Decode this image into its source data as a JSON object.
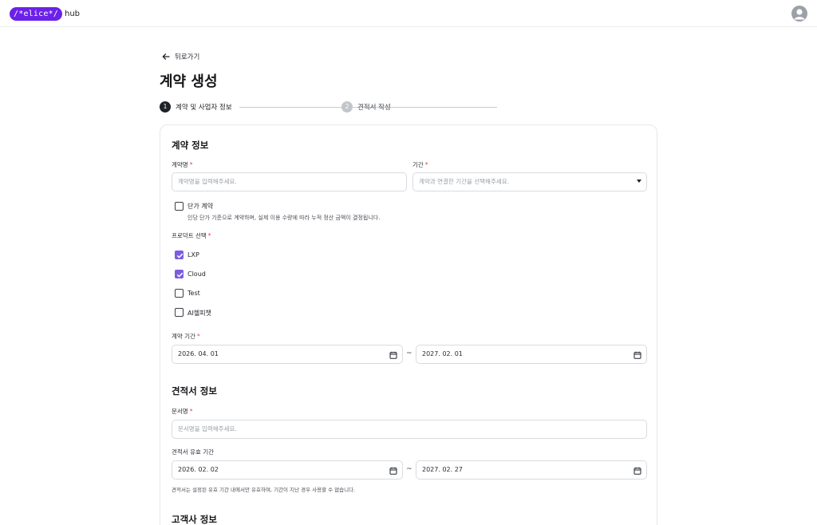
{
  "colors": {
    "brand": "#6b21e8",
    "accent_check": "#7c5ce0",
    "required": "#e5484d"
  },
  "header": {
    "logo_text": "/*elice*/",
    "logo_suffix": "hub",
    "avatar_icon": "user-icon"
  },
  "nav": {
    "back_label": "뒤로가기",
    "back_icon": "arrow-left-icon"
  },
  "page": {
    "title": "계약 생성"
  },
  "stepper": {
    "steps": [
      {
        "number": "1",
        "label": "계약 및 사업자 정보",
        "active": true
      },
      {
        "number": "2",
        "label": "견적서 작성",
        "active": false
      }
    ]
  },
  "contract": {
    "section_title": "계약 정보",
    "name_label": "계약명",
    "name_placeholder": "계약명을 입력해주세요.",
    "period_label": "기간",
    "period_placeholder": "계약과 연결한 기간을 선택해주세요.",
    "unit_price": {
      "label": "단가 계약",
      "checked": false,
      "hint": "인당 단가 기준으로 계약하며, 실제 이용 수량에 따라 누적 정산 금액이 결정됩니다."
    },
    "product_label": "프로덕트 선택",
    "products": [
      {
        "label": "LXP",
        "checked": true
      },
      {
        "label": "Cloud",
        "checked": true
      },
      {
        "label": "Test",
        "checked": false
      },
      {
        "label": "AI헬피챗",
        "checked": false
      }
    ],
    "term_label": "계약 기간",
    "term_start": "2026. 04. 01",
    "term_end": "2027. 02. 01",
    "range_sep": "~"
  },
  "quote": {
    "section_title": "견적서 정보",
    "doc_label": "문서명",
    "doc_placeholder": "문서명을 입력해주세요.",
    "valid_label": "견적서 유효 기간",
    "valid_start": "2026. 02. 02",
    "valid_end": "2027. 02. 27",
    "range_sep": "~",
    "valid_hint": "견적서는 설정된 유효 기간 내에서만 유효하며, 기간이 지난 경우 사용할 수 없습니다."
  },
  "customer": {
    "section_title": "고객사 정보"
  },
  "required_mark": "*"
}
